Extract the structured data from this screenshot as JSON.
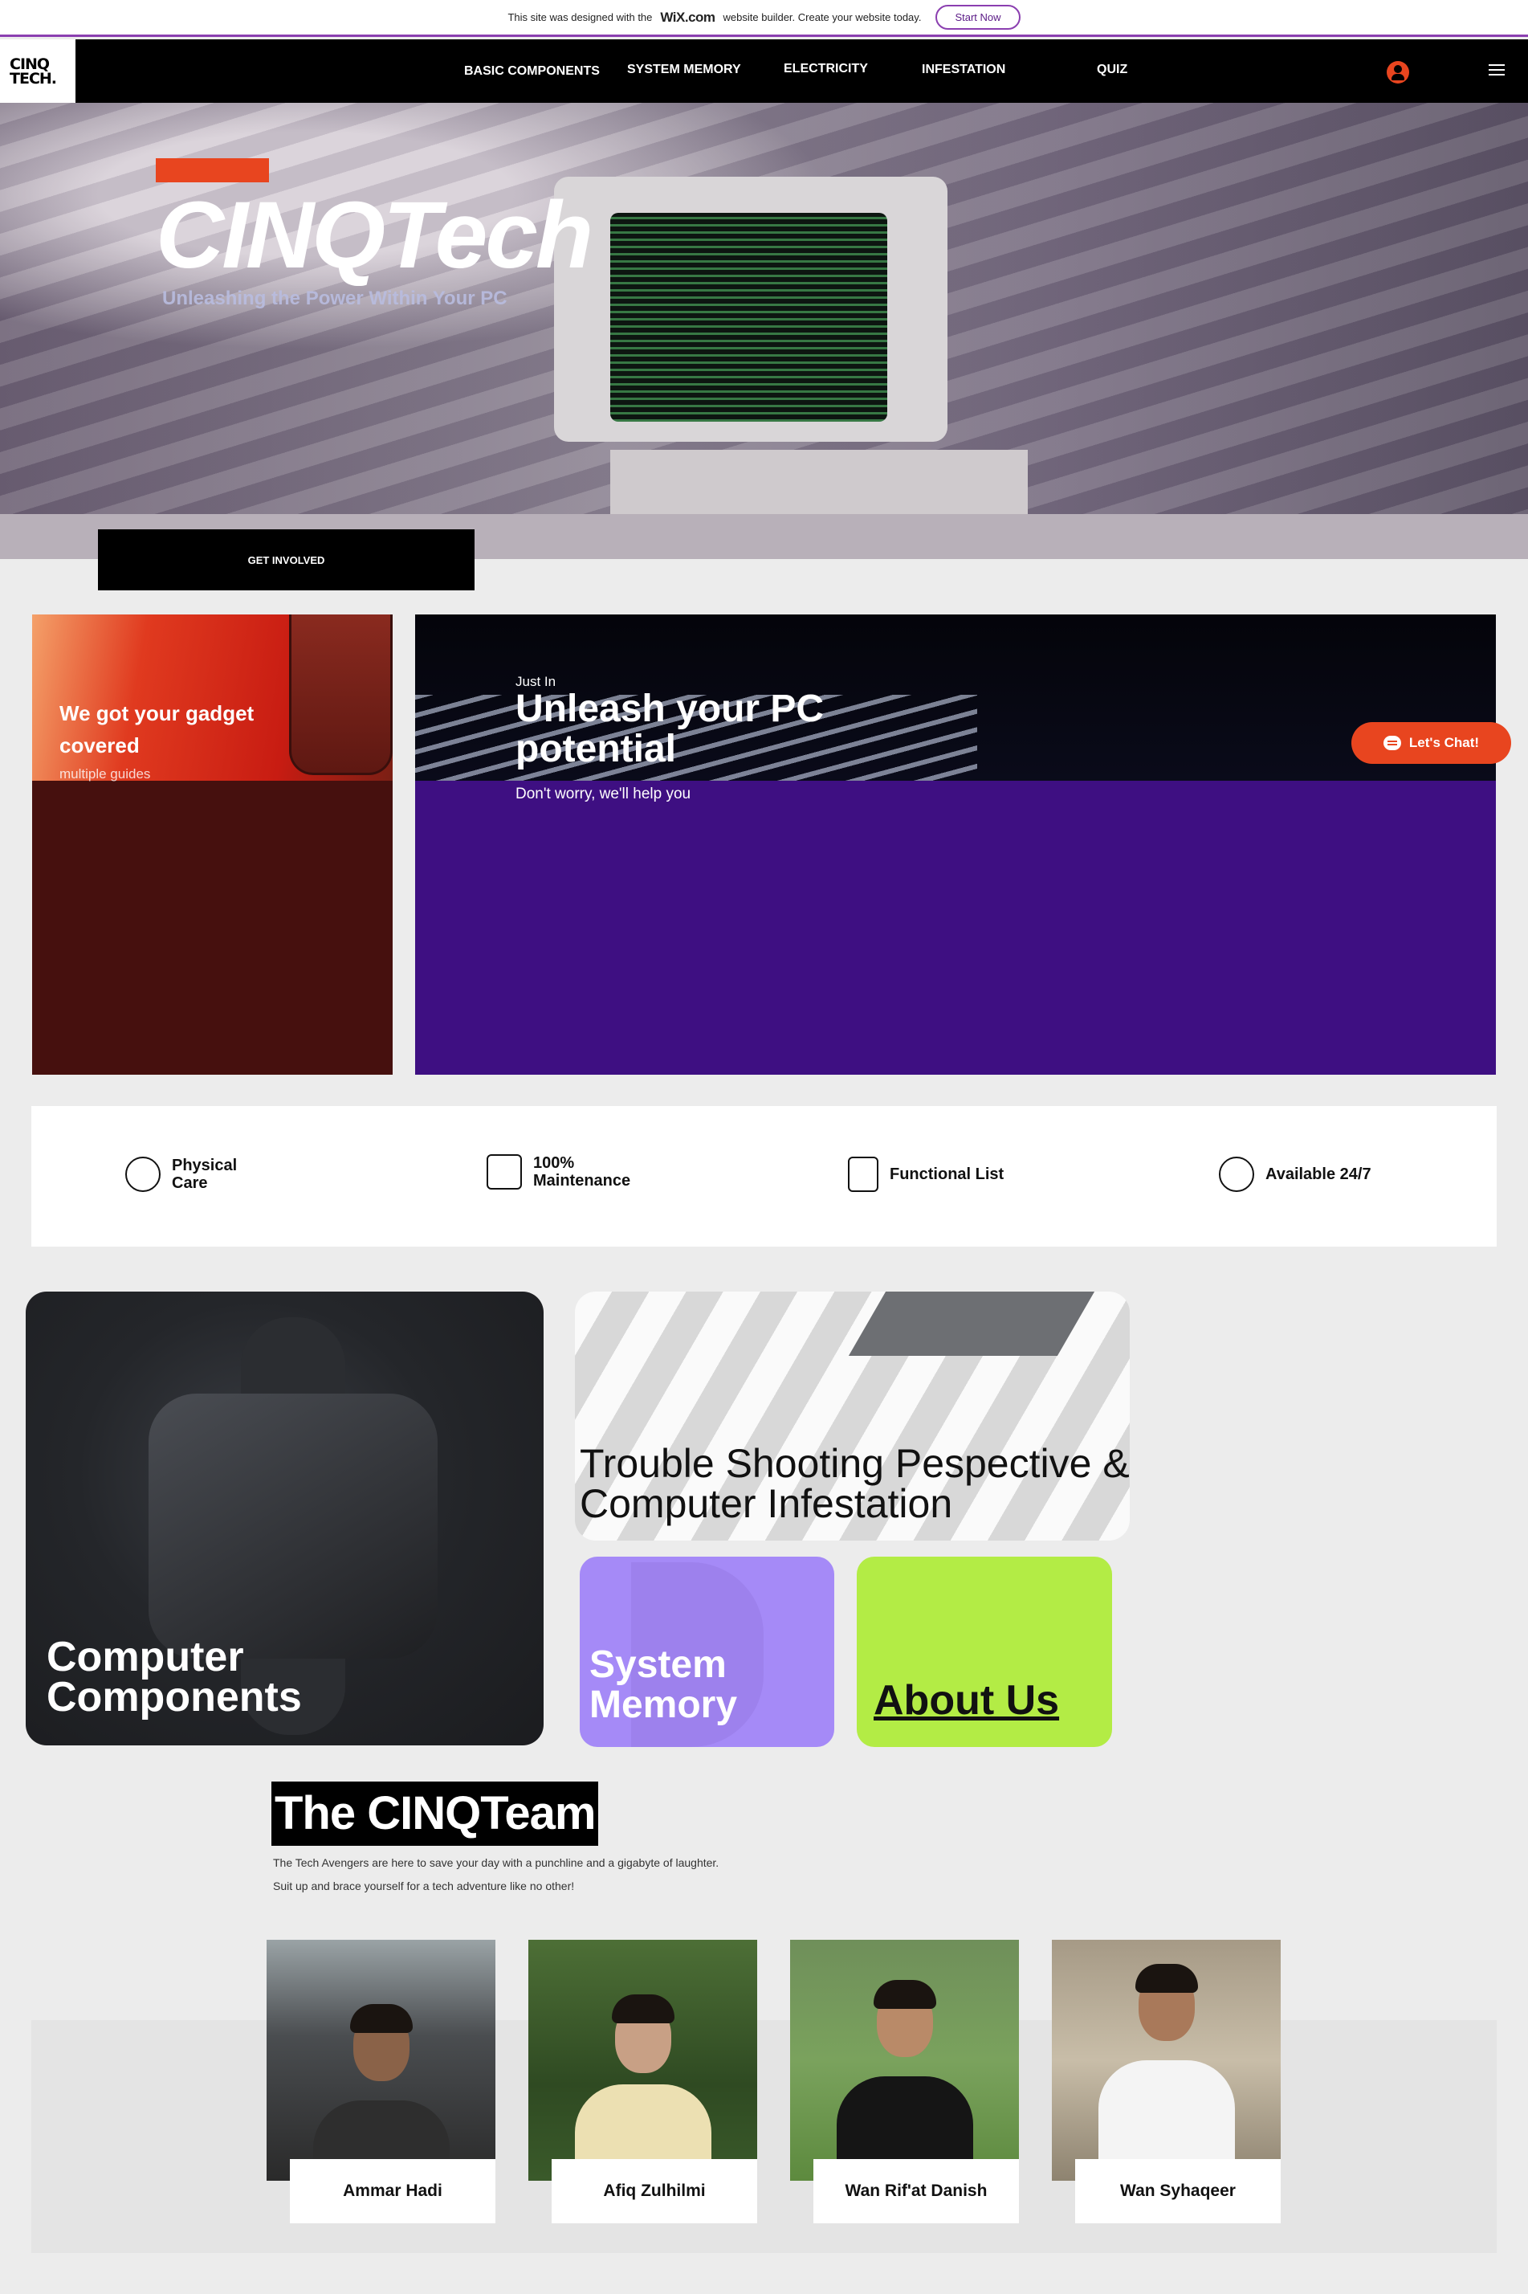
{
  "wix_banner": {
    "text_before": "This site was designed with the",
    "brand": "WiX.com",
    "text_after": "website builder. Create your website today.",
    "button": "Start Now"
  },
  "nav": {
    "logo_line1": "CINQ",
    "logo_line2": "TECH.",
    "items": [
      "BASIC COMPONENTS",
      "SYSTEM MEMORY",
      "ELECTRICITY",
      "INFESTATION",
      "QUIZ"
    ]
  },
  "hero": {
    "title": "CINQTech",
    "subtitle": "Unleashing the Power Within Your PC",
    "cta": "GET INVOLVED"
  },
  "promo": {
    "left_title": "We got your gadget covered",
    "left_sub": "multiple guides",
    "right_kicker": "Just In",
    "right_title": "Unleash your PC potential",
    "right_sub": "Don't worry, we'll help you"
  },
  "chat": {
    "label": "Let's Chat!"
  },
  "features": [
    {
      "label1": "Physical",
      "label2": "Care",
      "icon": "scooter-icon"
    },
    {
      "label1": "100%",
      "label2": "Maintenance",
      "icon": "box-check-icon"
    },
    {
      "label1": "Functional List",
      "label2": "",
      "icon": "percent-doc-icon"
    },
    {
      "label1": "Available 24/7",
      "label2": "",
      "icon": "clock-icon"
    }
  ],
  "tiles": {
    "components": "Computer Components",
    "trouble": "Trouble Shooting Pespective & Computer Infestation",
    "memory": "System Memory",
    "about": "About Us"
  },
  "team": {
    "title": "The CINQTeam",
    "desc1": "The Tech Avengers are here to save your day with a punchline and a gigabyte of laughter.",
    "desc2": "Suit up and brace yourself for a tech adventure like no other!",
    "members": [
      "Ammar Hadi",
      "Afiq Zulhilmi",
      "Wan Rif'at Danish",
      "Wan Syhaqeer"
    ]
  },
  "colors": {
    "accent": "#e8451f",
    "purple_card": "#3e0f82",
    "maroon_card": "#46100e",
    "memory_tile": "#a58af7",
    "about_tile": "#b3ec45"
  }
}
